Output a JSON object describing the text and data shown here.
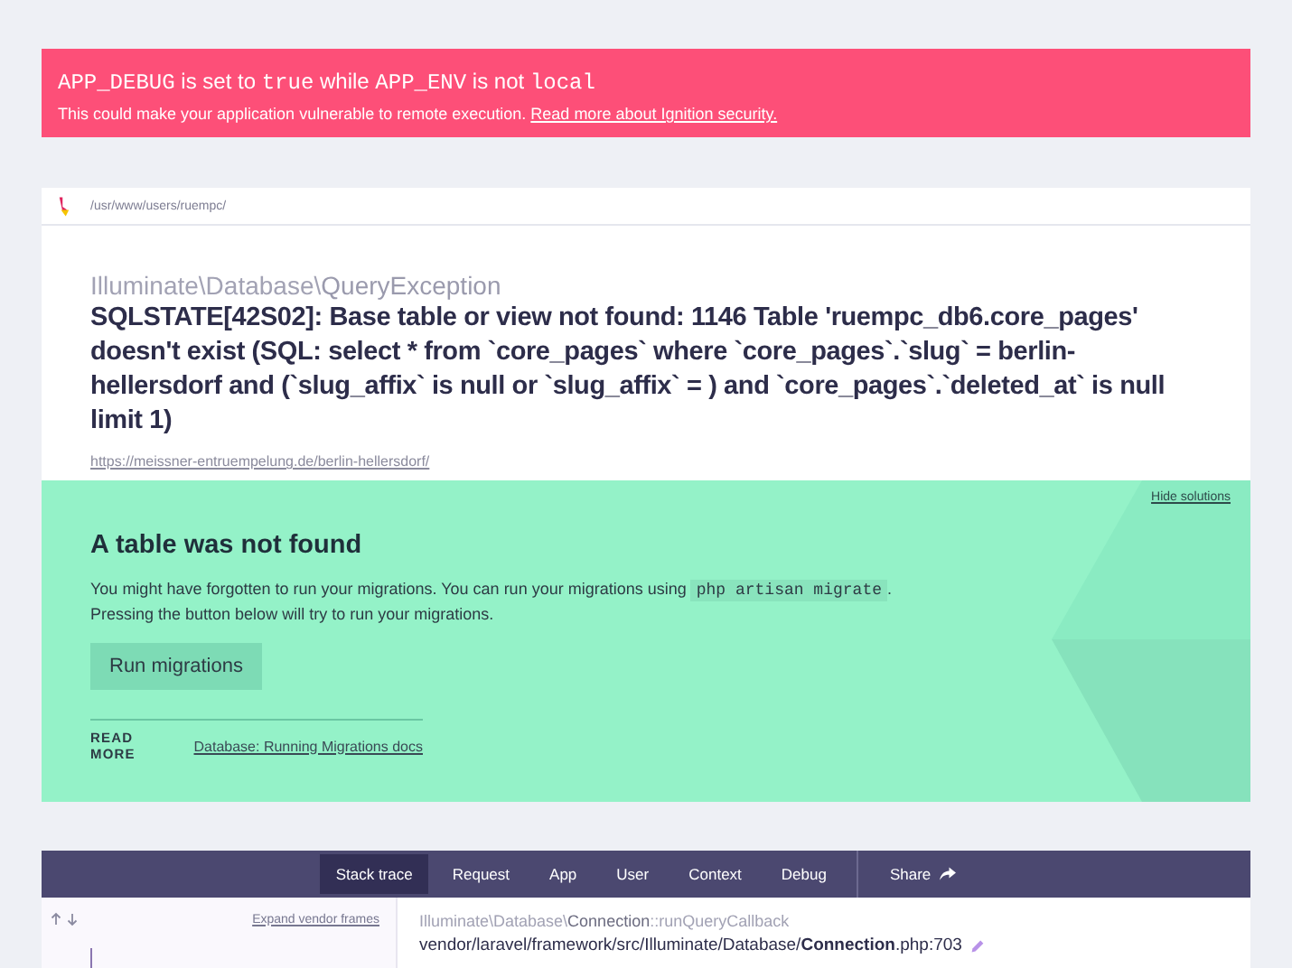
{
  "alert": {
    "title_parts": [
      {
        "kind": "code",
        "text": "APP_DEBUG"
      },
      {
        "kind": "text",
        "text": " is set to "
      },
      {
        "kind": "code",
        "text": "true"
      },
      {
        "kind": "text",
        "text": " while "
      },
      {
        "kind": "code",
        "text": "APP_ENV"
      },
      {
        "kind": "text",
        "text": " is not "
      },
      {
        "kind": "code",
        "text": "local"
      }
    ],
    "message": "This could make your application vulnerable to remote execution.",
    "link": "Read more about Ignition security."
  },
  "header": {
    "path": "/usr/www/users/ruempc/"
  },
  "exception": {
    "namespace": "Illuminate\\Database\\",
    "class": "QueryException",
    "message": "SQLSTATE[42S02]: Base table or view not found: 1146 Table 'ruempc_db6.core_pages' doesn't exist (SQL: select * from `core_pages` where `core_pages`.`slug` = berlin-hellersdorf and (`slug_affix` is null or `slug_affix` = ) and `core_pages`.`deleted_at` is null limit 1)",
    "url": "https://meissner-entruempelung.de/berlin-hellersdorf/"
  },
  "solution": {
    "hide_link": "Hide solutions",
    "title": "A table was not found",
    "description_parts": [
      {
        "kind": "text",
        "text": "You might have forgotten to run your migrations. You can run your migrations using "
      },
      {
        "kind": "code",
        "text": "php artisan migrate"
      },
      {
        "kind": "text",
        "text": "."
      }
    ],
    "description_2": "Pressing the button below will try to run your migrations.",
    "button": "Run migrations",
    "read_more_label": "READ MORE",
    "read_more_link": "Database: Running Migrations docs"
  },
  "tabs": [
    {
      "label": "Stack trace",
      "selected": true
    },
    {
      "label": "Request",
      "selected": false
    },
    {
      "label": "App",
      "selected": false
    },
    {
      "label": "User",
      "selected": false
    },
    {
      "label": "Context",
      "selected": false
    },
    {
      "label": "Debug",
      "selected": false
    }
  ],
  "share": "Share",
  "stack": {
    "expand_link": "Expand vendor frames",
    "frame": {
      "namespace": "Illuminate\\Database\\",
      "class": "Connection",
      "method": "::runQueryCallback",
      "file": "vendor/laravel/framework/src/Illuminate/Database/**Connection**.php:703"
    }
  }
}
